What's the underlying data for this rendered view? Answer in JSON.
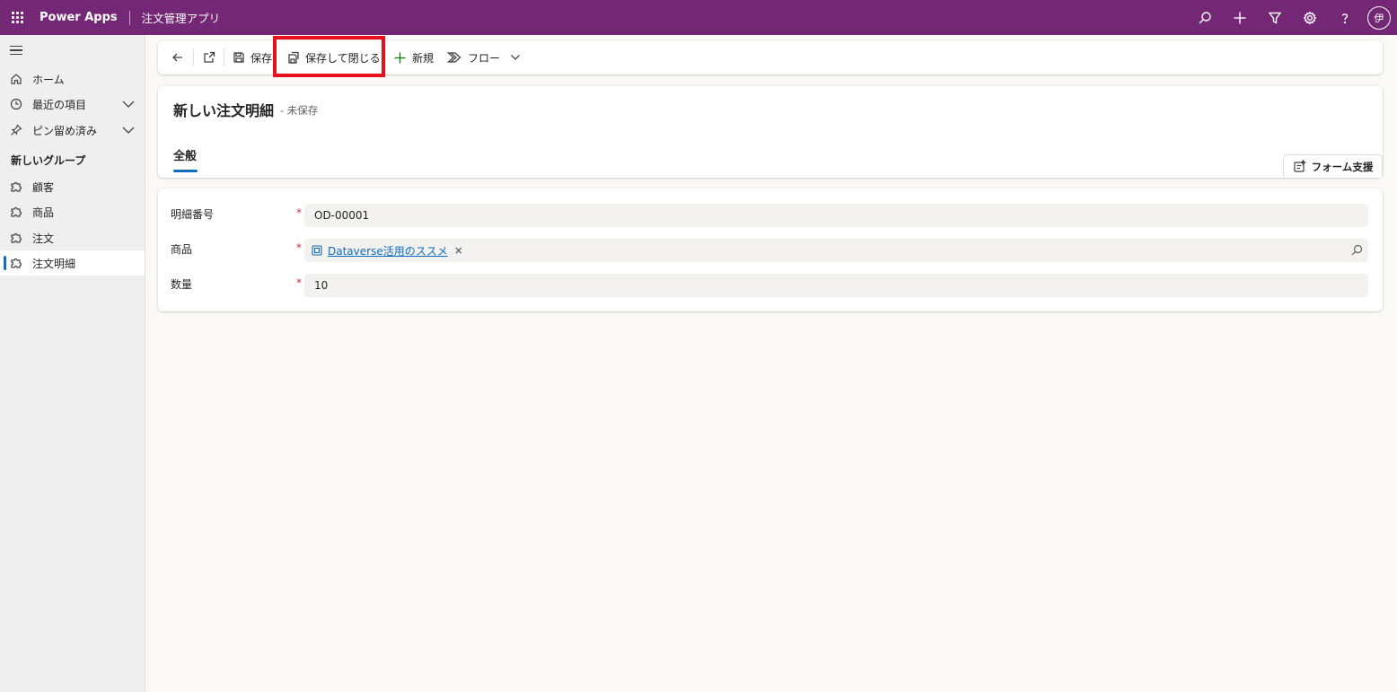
{
  "topbar": {
    "app_name": "Power Apps",
    "app_title": "注文管理アプリ",
    "avatar_initial": "伊",
    "icons": [
      "waffle-icon",
      "search-icon",
      "plus-icon",
      "filter-icon",
      "gear-icon",
      "help-icon"
    ]
  },
  "sidebar": {
    "items": [
      {
        "label": "ホーム",
        "icon": "home-icon"
      },
      {
        "label": "最近の項目",
        "icon": "clock-icon"
      },
      {
        "label": "ピン留め済み",
        "icon": "pin-icon"
      }
    ],
    "group_title": "新しいグループ",
    "group_items": [
      {
        "label": "顧客",
        "icon": "puzzle-icon"
      },
      {
        "label": "商品",
        "icon": "puzzle-icon"
      },
      {
        "label": "注文",
        "icon": "puzzle-icon"
      },
      {
        "label": "注文明細",
        "icon": "puzzle-icon",
        "active": true
      }
    ]
  },
  "commandbar": {
    "save": "保存",
    "save_and_close": "保存して閉じる",
    "new": "新規",
    "flow": "フロー"
  },
  "header": {
    "title": "新しい注文明細",
    "status": "- 未保存",
    "tab": "全般",
    "form_assist": "フォーム支援"
  },
  "form": {
    "fields": [
      {
        "label": "明細番号",
        "value": "OD-00001"
      },
      {
        "label": "商品",
        "value": "Dataverse活用のススメ"
      },
      {
        "label": "数量",
        "value": "10"
      }
    ],
    "required_mark": "*",
    "lookup_remove": "×"
  },
  "colors": {
    "topbar": "#742774",
    "accent": "#0f6cbd",
    "highlight": "#e8101c",
    "required": "#c4314b"
  }
}
